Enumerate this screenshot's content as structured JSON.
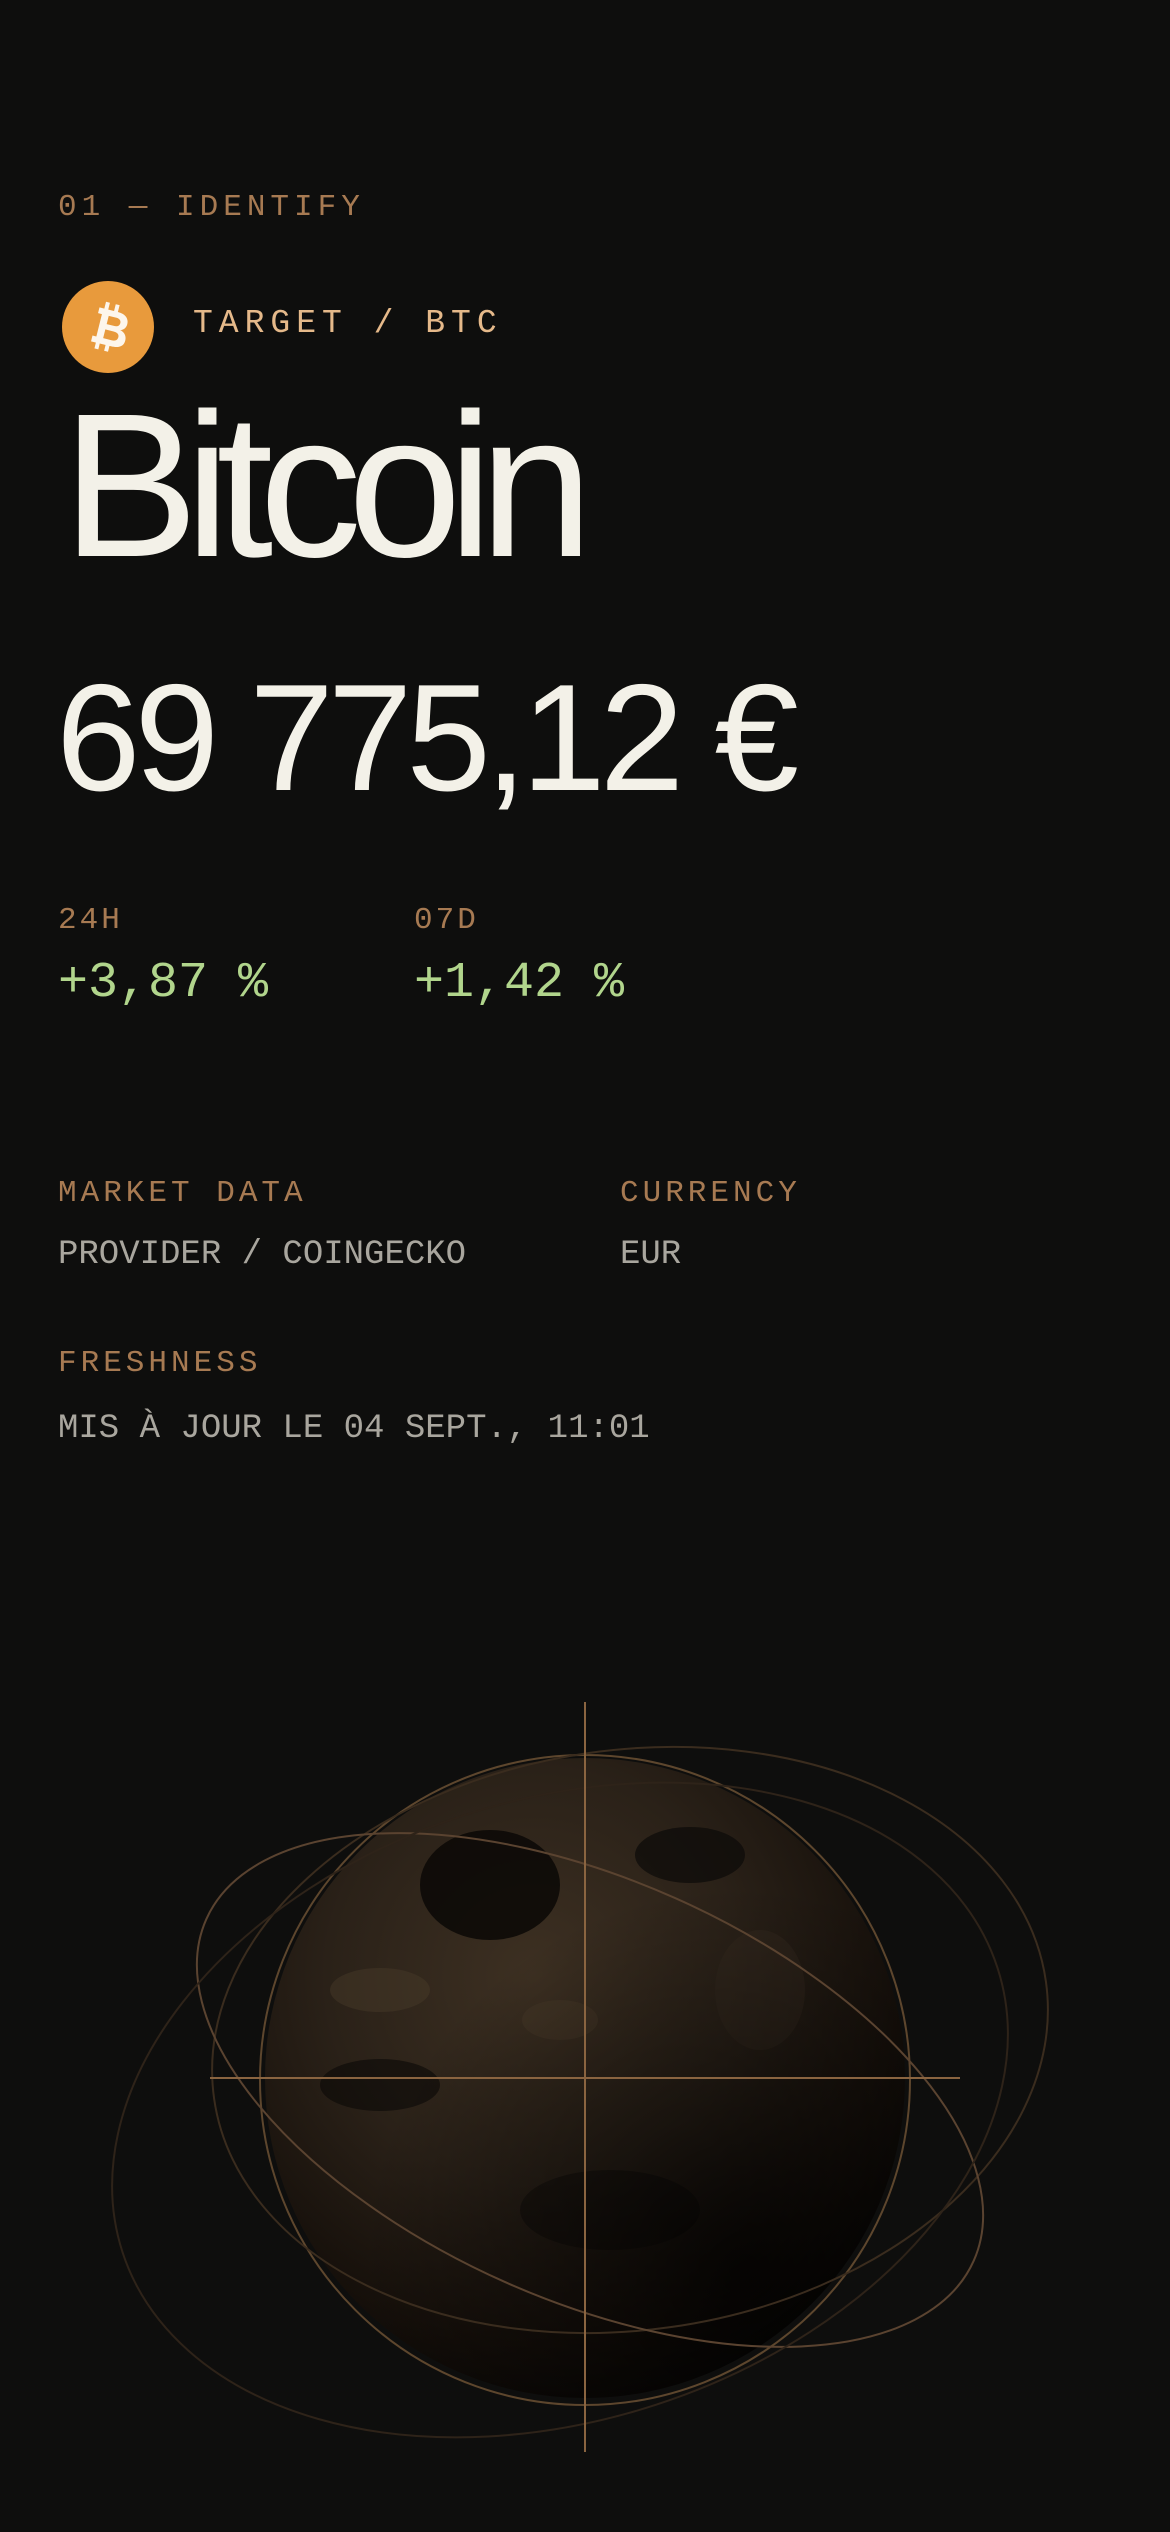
{
  "step": {
    "label": "01 — IDENTIFY"
  },
  "asset": {
    "icon": "bitcoin-icon",
    "icon_color": "#e89a3c",
    "target_label": "TARGET / BTC",
    "name": "Bitcoin"
  },
  "price": {
    "value": "69 775,12 €"
  },
  "stats": [
    {
      "label": "24H",
      "value": "+3,87 %"
    },
    {
      "label": "07D",
      "value": "+1,42 %"
    }
  ],
  "meta": {
    "market_data_label": "MARKET DATA",
    "market_data_value": "PROVIDER / COINGECKO",
    "currency_label": "CURRENCY",
    "currency_value": "EUR",
    "freshness_label": "FRESHNESS",
    "freshness_value": "MIS À JOUR LE 04 SEPT., 11:01"
  },
  "colors": {
    "background": "#0e0e0d",
    "accent": "#a77a52",
    "positive": "#b1d58c",
    "text": "#f3f1e8"
  },
  "illustration": {
    "icon": "globe-crosshair-icon"
  }
}
